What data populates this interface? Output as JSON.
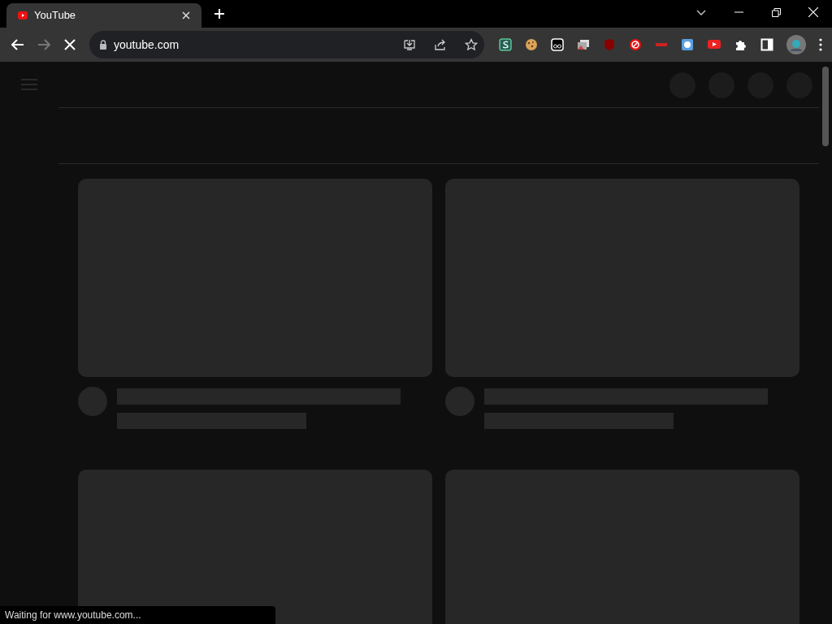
{
  "tabs": [
    {
      "title": "YouTube",
      "selected": true
    }
  ],
  "toolbar": {
    "url": "youtube.com",
    "loading": true
  },
  "feed": {
    "cards": [
      {
        "kind": "skeleton"
      },
      {
        "kind": "skeleton"
      },
      {
        "kind": "thumbnail"
      },
      {
        "kind": "thumbnail"
      }
    ]
  },
  "status_bubble": "Waiting for www.youtube.com..."
}
